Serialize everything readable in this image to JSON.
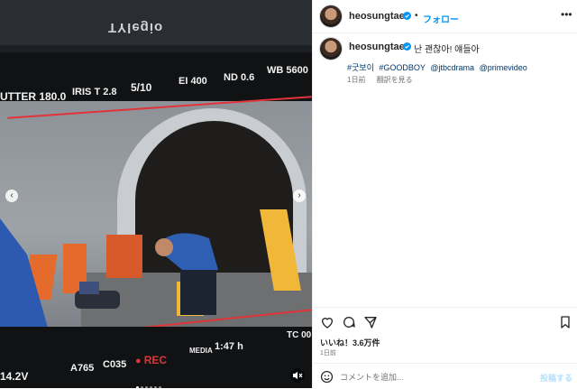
{
  "media": {
    "brand_text": "TYlegio",
    "hud_top": {
      "shutter": "UTTER 180.0",
      "iris": "IRIS T 2.8",
      "fraction": "5/10",
      "ei": "EI 400",
      "nd": "ND 0.6",
      "wb": "WB 5600"
    },
    "hud_bottom": {
      "lens": "A765",
      "clip": "C035",
      "rec": "REC",
      "media_label": "MEDIA",
      "media_time": "1:47 h",
      "tc": "TC 00",
      "voltage": "14.2V"
    },
    "nav_left_icon": "chevron-left",
    "nav_right_icon": "chevron-right",
    "rec_color": "#e0343a"
  },
  "header": {
    "username": "heosungtae",
    "separator": "•",
    "follow_label": "フォロー",
    "more_icon": "ellipsis"
  },
  "caption": {
    "username": "heosungtae",
    "text": "난 괜찮아! 얘들아",
    "hashtags": [
      "#굿보이",
      "#GOODBOY",
      "@jtbcdrama",
      "@primevideo"
    ],
    "time": "1日前",
    "translate_label": "翻訳を見る"
  },
  "engagement": {
    "likes": "いいね！3.6万件",
    "date": "1日前"
  },
  "comment": {
    "placeholder": "コメントを追加...",
    "post_label": "投稿する"
  },
  "colors": {
    "link": "#00376b",
    "follow": "#0095f6",
    "verified": "#0095f6",
    "post_disabled": "#b2dffc"
  }
}
